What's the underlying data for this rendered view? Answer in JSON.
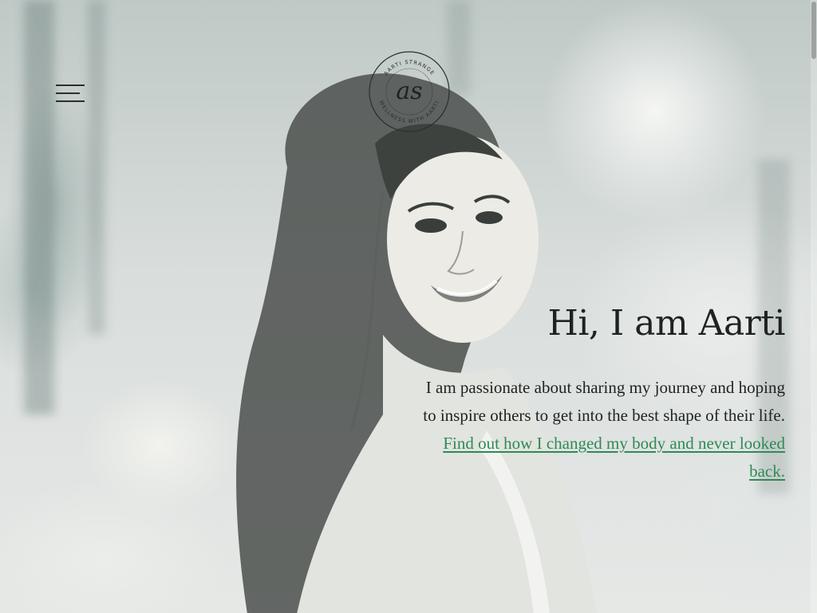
{
  "header": {
    "menu_icon": "hamburger-menu-icon",
    "logo": {
      "monogram": "as",
      "top_text": "AARTI STRANGE",
      "bottom_text": "WELLNESS WITH AARTI"
    }
  },
  "hero": {
    "heading": "Hi, I am Aarti",
    "intro_text": "I am passionate about sharing my journey and hoping to inspire others to get into the best shape of their life.",
    "link_text": "Find out how I changed my body and never looked back."
  },
  "colors": {
    "text": "#1e2221",
    "link": "#2e8a55",
    "background_tint": "#cfd6d3"
  }
}
